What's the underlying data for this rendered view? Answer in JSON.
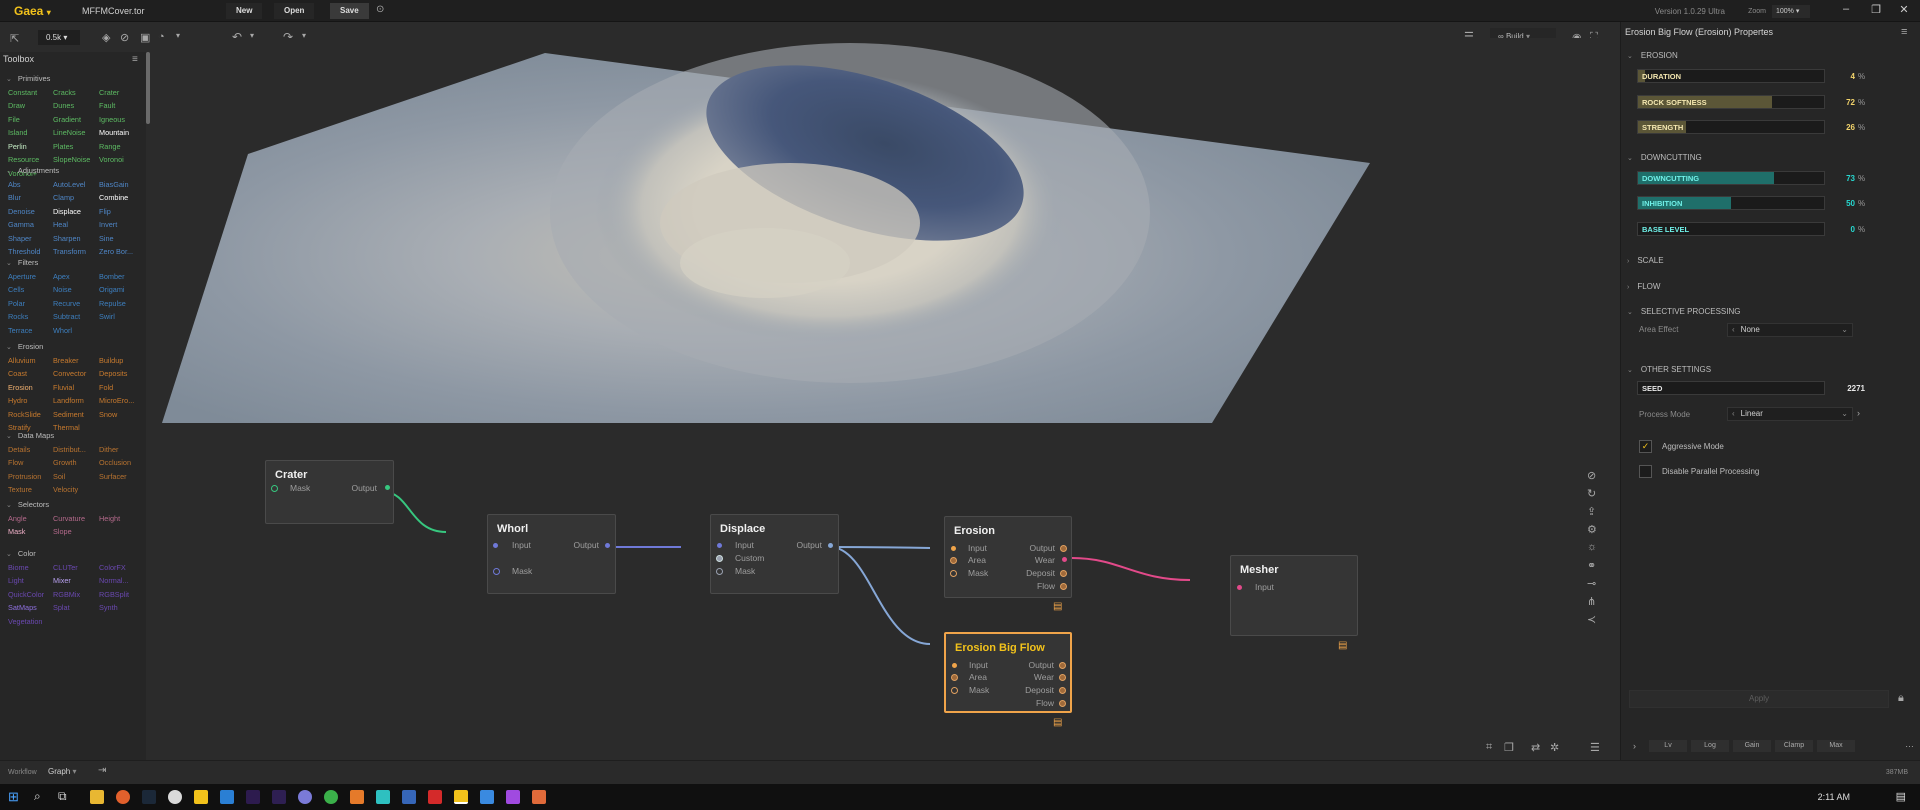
{
  "app": {
    "name": "Gaea",
    "file": "MFFMCover.tor",
    "version": "Version 1.0.29 Ultra",
    "zoom_label": "Zoom",
    "zoom_value": "100%"
  },
  "menu": {
    "new": "New",
    "open": "Open",
    "save": "Save"
  },
  "toolbar": {
    "resolution": "0.5k",
    "build": "Build"
  },
  "toolbox": {
    "title": "Toolbox",
    "sections": [
      {
        "name": "Primitives",
        "color": "#5dbb63",
        "items": [
          "Constant",
          "Cracks",
          "Crater",
          "Draw",
          "Dunes",
          "Fault",
          "File",
          "Gradient",
          "Igneous",
          "Island",
          "LineNoise",
          "Mountain",
          "Perlin",
          "Plates",
          "Range",
          "Resource",
          "SlopeNoise",
          "Voronoi",
          "Voronoi+"
        ]
      },
      {
        "name": "Adjustments",
        "color": "#4f86c6",
        "items": [
          "Abs",
          "AutoLevel",
          "BiasGain",
          "Blur",
          "Clamp",
          "Combine",
          "Denoise",
          "Displace",
          "Flip",
          "Gamma",
          "Heal",
          "Invert",
          "Shaper",
          "Sharpen",
          "Sine",
          "Threshold",
          "Transform",
          "Zero Bor..."
        ]
      },
      {
        "name": "Filters",
        "color": "#3d7fbf",
        "items": [
          "Aperture",
          "Apex",
          "Bomber",
          "Cells",
          "Noise",
          "Origami",
          "Polar",
          "Recurve",
          "Repulse",
          "Rocks",
          "Subtract",
          "Swirl",
          "Terrace",
          "Whorl"
        ]
      },
      {
        "name": "Erosion",
        "color": "#c77a2e",
        "items": [
          "Alluvium",
          "Breaker",
          "Buildup",
          "Coast",
          "Convector",
          "Deposits",
          "Erosion",
          "Fluvial",
          "Fold",
          "Hydro",
          "Landform",
          "MicroEro...",
          "RockSlide",
          "Sediment",
          "Snow",
          "Stratify",
          "Thermal"
        ]
      },
      {
        "name": "Data Maps",
        "color": "#b87330",
        "items": [
          "Details",
          "Distribut...",
          "Dither",
          "Flow",
          "Growth",
          "Occlusion",
          "Protrusion",
          "Soil",
          "Surfacer",
          "Texture",
          "Velocity"
        ]
      },
      {
        "name": "Selectors",
        "color": "#b56a8c",
        "items": [
          "Angle",
          "Curvature",
          "Height",
          "Mask",
          "Slope"
        ]
      },
      {
        "name": "Color",
        "color": "#6a48b0",
        "items": [
          "Biome",
          "CLUTer",
          "ColorFX",
          "Light",
          "Mixer",
          "Normal...",
          "QuickColor",
          "RGBMix",
          "RGBSplit",
          "SatMaps",
          "Splat",
          "Synth",
          "Vegetation"
        ]
      }
    ]
  },
  "graph": {
    "nodes": [
      {
        "id": "crater",
        "title": "Crater",
        "inputs": [
          "Mask"
        ],
        "outputs": [
          "Output"
        ]
      },
      {
        "id": "whorl",
        "title": "Whorl",
        "inputs": [
          "Input",
          "Mask"
        ],
        "outputs": [
          "Output"
        ]
      },
      {
        "id": "displace",
        "title": "Displace",
        "inputs": [
          "Input",
          "Custom",
          "Mask"
        ],
        "outputs": [
          "Output"
        ]
      },
      {
        "id": "erosion",
        "title": "Erosion",
        "inputs": [
          "Input",
          "Area",
          "Mask"
        ],
        "outputs": [
          "Output",
          "Wear",
          "Deposit",
          "Flow"
        ]
      },
      {
        "id": "ebf",
        "title": "Erosion Big Flow",
        "inputs": [
          "Input",
          "Area",
          "Mask"
        ],
        "outputs": [
          "Output",
          "Wear",
          "Deposit",
          "Flow"
        ]
      },
      {
        "id": "mesher",
        "title": "Mesher",
        "inputs": [
          "Input"
        ],
        "outputs": []
      }
    ]
  },
  "properties": {
    "title": "Erosion Big Flow (Erosion) Propertes",
    "erosion_group": "EROSION",
    "duration": {
      "label": "DURATION",
      "value": 4
    },
    "rock_softness": {
      "label": "ROCK SOFTNESS",
      "value": 72
    },
    "strength": {
      "label": "STRENGTH",
      "value": 26
    },
    "downcutting_group": "DOWNCUTTING",
    "downcutting": {
      "label": "DOWNCUTTING",
      "value": 73
    },
    "inhibition": {
      "label": "INHIBITION",
      "value": 50
    },
    "base_level": {
      "label": "BASE LEVEL",
      "value": 0
    },
    "pct": "%",
    "scale_group": "SCALE",
    "flow_group": "FLOW",
    "selective_group": "SELECTIVE PROCESSING",
    "area_effect_label": "Area Effect",
    "area_effect_value": "None",
    "other_group": "OTHER SETTINGS",
    "seed": {
      "label": "SEED",
      "value": "2271"
    },
    "process_mode_label": "Process Mode",
    "process_mode_value": "Linear",
    "aggressive_mode": "Aggressive Mode",
    "disable_parallel": "Disable Parallel Processing",
    "apply": "Apply",
    "footer_tabs": [
      "Lv",
      "Log",
      "Gain",
      "Clamp",
      "Max"
    ],
    "memory": "387MB"
  },
  "workflow": {
    "label": "Workflow",
    "mode": "Graph"
  },
  "taskbar": {
    "time": "2:11 AM"
  },
  "colors": {
    "accent": "#f2c21b",
    "erosion_slider": "#5b5637",
    "downcut_slider": "#1f6f6a",
    "cyan_value": "#27d8d0",
    "yellow_value": "#f2d36b"
  }
}
